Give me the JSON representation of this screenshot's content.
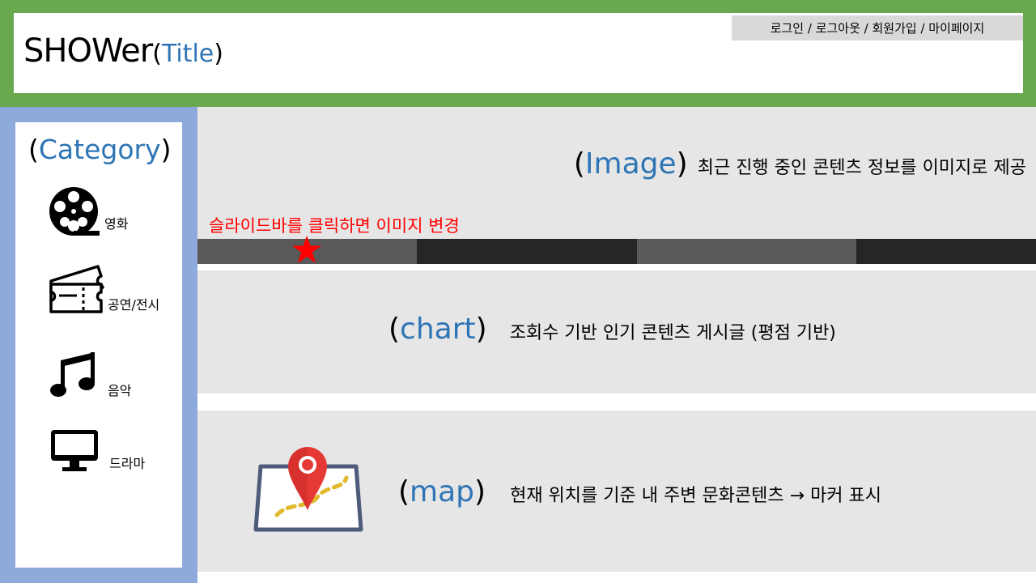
{
  "header": {
    "title": "SHOWer",
    "title_annotation": "Title",
    "auth_links": "로그인 / 로그아웃 / 회원가입 / 마이페이지"
  },
  "sidebar": {
    "title": "Category",
    "items": [
      {
        "label": "영화",
        "icon": "film-reel-icon"
      },
      {
        "label": "공연/전시",
        "icon": "ticket-icon"
      },
      {
        "label": "음악",
        "icon": "music-note-icon"
      },
      {
        "label": "드라마",
        "icon": "monitor-icon"
      }
    ]
  },
  "image_section": {
    "label": "Image",
    "description": "최근 진행 중인 콘텐츠 정보를 이미지로 제공",
    "slider_hint": "슬라이드바를 클릭하면 이미지 변경"
  },
  "chart_section": {
    "label": "chart",
    "description": "조회수 기반 인기 콘텐츠 게시글 (평점 기반)"
  },
  "map_section": {
    "label": "map",
    "description": "현재 위치를 기준 내 주변 문화콘텐츠 → 마커 표시"
  },
  "colors": {
    "header_green": "#6aa84f",
    "sidebar_blue": "#8eaadb",
    "accent_blue": "#2e75b6",
    "hint_red": "#ff0000"
  }
}
